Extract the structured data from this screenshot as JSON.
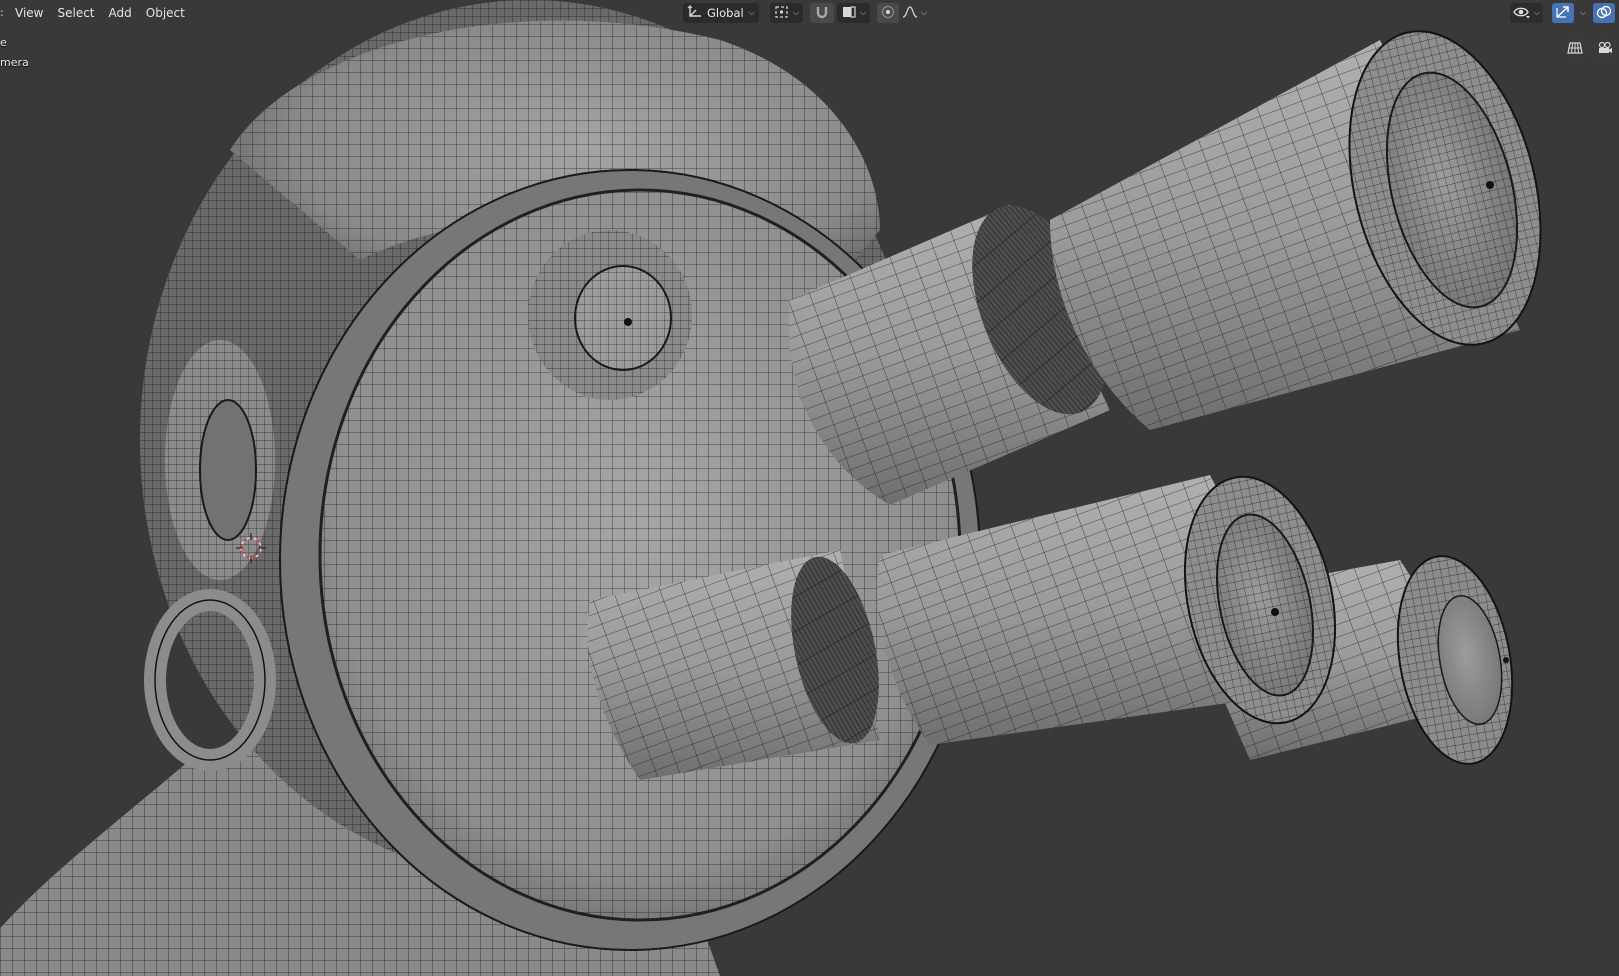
{
  "app": "Blender",
  "header": {
    "menus": [
      {
        "label": "View"
      },
      {
        "label": "Select"
      },
      {
        "label": "Add"
      },
      {
        "label": "Object"
      }
    ],
    "transform_orientation": "Global",
    "icons": {
      "orientation": "transform-orientation-icon",
      "pivot": "pivot-point-icon",
      "snap": "snap-magnet-icon",
      "snap_target": "snap-target-icon",
      "proportional": "proportional-editing-icon",
      "falloff": "proportional-falloff-icon",
      "visibility": "object-visibility-icon",
      "gizmo": "gizmo-toggle-icon",
      "overlays": "overlays-icon"
    }
  },
  "viewport_info": {
    "line1": "e",
    "line2": "mera"
  },
  "nav_gizmo": {
    "icons": [
      "grid-view-icon",
      "camera-view-icon"
    ]
  },
  "colors": {
    "background": "#393939",
    "mesh_surface": "#8e8e8e",
    "wire": "#141414",
    "accent": "#4772b3",
    "cursor": "#d64040"
  }
}
